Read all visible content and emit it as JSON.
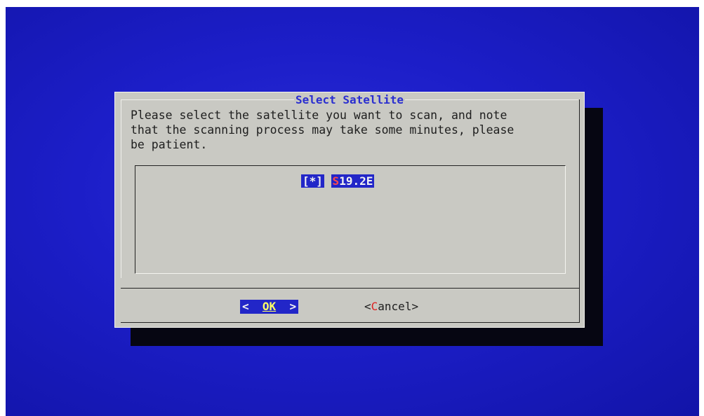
{
  "dialog": {
    "title": "Select Satellite",
    "message": "Please select the satellite you want to scan, and note\nthat the scanning process may take some minutes, please\nbe patient."
  },
  "list": {
    "items": [
      {
        "check": "[*]",
        "hotkey": "S",
        "rest": "19.2E",
        "selected": true
      }
    ]
  },
  "buttons": {
    "ok": {
      "left": "<",
      "label": "OK",
      "right": ">"
    },
    "cancel": {
      "open": "<",
      "hotkey": "C",
      "rest": "ancel",
      "close": ">"
    }
  },
  "colors": {
    "background": "#1c1ec8",
    "dialog": "#c9c9c3",
    "highlight": "#2226c8",
    "hotkey": "#d22"
  }
}
